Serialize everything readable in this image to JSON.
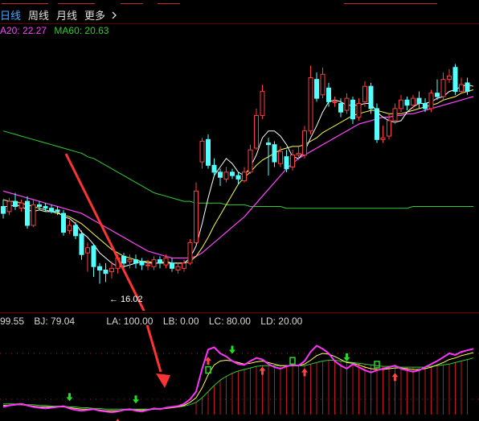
{
  "period_tabs": [
    {
      "label": "日线",
      "active": true
    },
    {
      "label": "周线",
      "active": false
    },
    {
      "label": "月线",
      "active": false
    }
  ],
  "more_menu": {
    "label": "更多",
    "icon": "chevron-right-icon"
  },
  "ma_legend": {
    "ma20": "A20: 22.27",
    "ma60": "MA60: 20.63"
  },
  "indicator_values": {
    "v1": "99.55",
    "bj": "BJ: 79.04",
    "la": "LA: 100.00",
    "lb": "LB: 0.00",
    "lc": "LC: 80.00",
    "ld": "LD: 20.00"
  },
  "low_price_label": "← 16.02",
  "colors": {
    "background": "#000000",
    "up_candle": "#ff3b3b",
    "down_candle": "#54ffff",
    "ma5": "#ffffff",
    "ma10": "#ffff55",
    "ma20": "#ff44ff",
    "ma60": "#33cc33",
    "annotation_arrow": "#ff3333",
    "buy_signal": "#ff4444",
    "sell_signal": "#22dd22",
    "indicator_line_main": "#ff33ff"
  },
  "candles": [
    {
      "o": 20.6,
      "c": 20.2,
      "h": 21.0,
      "l": 19.9
    },
    {
      "o": 20.3,
      "c": 20.9,
      "h": 21.1,
      "l": 20.1
    },
    {
      "o": 20.9,
      "c": 20.6,
      "h": 21.4,
      "l": 20.4
    },
    {
      "o": 20.5,
      "c": 20.8,
      "h": 21.0,
      "l": 20.3
    },
    {
      "o": 20.9,
      "c": 19.5,
      "h": 21.2,
      "l": 19.3
    },
    {
      "o": 19.5,
      "c": 20.7,
      "h": 21.0,
      "l": 19.4
    },
    {
      "o": 20.7,
      "c": 20.6,
      "h": 20.9,
      "l": 20.4
    },
    {
      "o": 20.6,
      "c": 20.5,
      "h": 20.8,
      "l": 20.3
    },
    {
      "o": 20.5,
      "c": 20.3,
      "h": 20.7,
      "l": 20.2
    },
    {
      "o": 20.4,
      "c": 20.3,
      "h": 20.6,
      "l": 20.1
    },
    {
      "o": 20.2,
      "c": 19.1,
      "h": 20.4,
      "l": 18.9
    },
    {
      "o": 19.2,
      "c": 19.5,
      "h": 19.8,
      "l": 19.0
    },
    {
      "o": 19.5,
      "c": 18.9,
      "h": 19.7,
      "l": 18.7
    },
    {
      "o": 19.0,
      "c": 17.8,
      "h": 19.2,
      "l": 17.5
    },
    {
      "o": 17.9,
      "c": 18.2,
      "h": 18.5,
      "l": 16.8
    },
    {
      "o": 18.3,
      "c": 17.1,
      "h": 18.4,
      "l": 16.5
    },
    {
      "o": 17.1,
      "c": 16.9,
      "h": 17.3,
      "l": 16.1
    },
    {
      "o": 16.9,
      "c": 16.7,
      "h": 17.3,
      "l": 16.2
    },
    {
      "o": 16.8,
      "c": 17.0,
      "h": 17.4,
      "l": 16.4
    },
    {
      "o": 17.0,
      "c": 17.6,
      "h": 17.8,
      "l": 16.7
    },
    {
      "o": 17.7,
      "c": 17.3,
      "h": 17.9,
      "l": 17.0
    },
    {
      "o": 17.4,
      "c": 17.5,
      "h": 17.8,
      "l": 17.0
    },
    {
      "o": 17.5,
      "c": 17.3,
      "h": 17.8,
      "l": 17.0
    },
    {
      "o": 17.4,
      "c": 17.2,
      "h": 17.6,
      "l": 16.9
    },
    {
      "o": 17.2,
      "c": 17.2,
      "h": 17.5,
      "l": 16.9
    },
    {
      "o": 17.1,
      "c": 17.5,
      "h": 17.7,
      "l": 16.9
    },
    {
      "o": 17.5,
      "c": 17.3,
      "h": 17.7,
      "l": 17.0
    },
    {
      "o": 17.2,
      "c": 17.6,
      "h": 17.8,
      "l": 17.0
    },
    {
      "o": 17.3,
      "c": 17.0,
      "h": 17.6,
      "l": 16.8
    },
    {
      "o": 16.9,
      "c": 17.1,
      "h": 17.3,
      "l": 16.7
    },
    {
      "o": 17.0,
      "c": 17.3,
      "h": 17.5,
      "l": 16.8
    },
    {
      "o": 17.3,
      "c": 18.5,
      "h": 18.7,
      "l": 17.2
    },
    {
      "o": 18.5,
      "c": 21.5,
      "h": 22.0,
      "l": 18.4
    },
    {
      "o": 23.2,
      "c": 24.4,
      "h": 24.6,
      "l": 22.8
    },
    {
      "o": 24.5,
      "c": 23.0,
      "h": 24.8,
      "l": 22.8
    },
    {
      "o": 23.0,
      "c": 22.6,
      "h": 23.4,
      "l": 22.4
    },
    {
      "o": 22.6,
      "c": 22.3,
      "h": 22.8,
      "l": 21.8
    },
    {
      "o": 22.2,
      "c": 22.6,
      "h": 22.9,
      "l": 22.0
    },
    {
      "o": 22.6,
      "c": 22.4,
      "h": 22.8,
      "l": 22.2
    },
    {
      "o": 22.4,
      "c": 22.2,
      "h": 22.6,
      "l": 21.9
    },
    {
      "o": 22.1,
      "c": 22.6,
      "h": 22.9,
      "l": 22.0
    },
    {
      "o": 22.6,
      "c": 23.9,
      "h": 24.2,
      "l": 22.5
    },
    {
      "o": 24.0,
      "c": 25.9,
      "h": 26.3,
      "l": 23.9
    },
    {
      "o": 25.9,
      "c": 27.3,
      "h": 27.7,
      "l": 25.7
    },
    {
      "o": 24.3,
      "c": 24.2,
      "h": 24.6,
      "l": 22.4
    },
    {
      "o": 24.2,
      "c": 23.2,
      "h": 24.4,
      "l": 22.9
    },
    {
      "o": 23.1,
      "c": 23.8,
      "h": 24.1,
      "l": 22.9
    },
    {
      "o": 23.5,
      "c": 22.8,
      "h": 23.9,
      "l": 22.6
    },
    {
      "o": 22.9,
      "c": 23.6,
      "h": 23.9,
      "l": 22.7
    },
    {
      "o": 23.6,
      "c": 23.7,
      "h": 24.1,
      "l": 23.3
    },
    {
      "o": 23.6,
      "c": 25.0,
      "h": 25.3,
      "l": 23.4
    },
    {
      "o": 25.0,
      "c": 28.1,
      "h": 28.8,
      "l": 24.8
    },
    {
      "o": 28.0,
      "c": 26.9,
      "h": 28.4,
      "l": 26.7
    },
    {
      "o": 27.1,
      "c": 28.3,
      "h": 28.7,
      "l": 26.9
    },
    {
      "o": 27.5,
      "c": 26.7,
      "h": 27.8,
      "l": 26.4
    },
    {
      "o": 26.7,
      "c": 26.7,
      "h": 27.0,
      "l": 26.4
    },
    {
      "o": 26.6,
      "c": 26.1,
      "h": 26.9,
      "l": 25.8
    },
    {
      "o": 26.2,
      "c": 26.9,
      "h": 27.2,
      "l": 26.0
    },
    {
      "o": 26.8,
      "c": 25.7,
      "h": 27.0,
      "l": 25.4
    },
    {
      "o": 25.8,
      "c": 26.6,
      "h": 26.9,
      "l": 25.6
    },
    {
      "o": 26.7,
      "c": 27.6,
      "h": 27.9,
      "l": 26.4
    },
    {
      "o": 27.6,
      "c": 26.3,
      "h": 27.8,
      "l": 26.0
    },
    {
      "o": 26.3,
      "c": 24.5,
      "h": 26.6,
      "l": 24.3
    },
    {
      "o": 24.5,
      "c": 24.6,
      "h": 25.3,
      "l": 24.3
    },
    {
      "o": 24.7,
      "c": 25.6,
      "h": 26.0,
      "l": 24.5
    },
    {
      "o": 25.6,
      "c": 26.3,
      "h": 26.6,
      "l": 25.4
    },
    {
      "o": 26.3,
      "c": 26.8,
      "h": 27.1,
      "l": 26.1
    },
    {
      "o": 26.8,
      "c": 26.5,
      "h": 27.0,
      "l": 26.2
    },
    {
      "o": 26.5,
      "c": 26.9,
      "h": 27.1,
      "l": 26.3
    },
    {
      "o": 26.9,
      "c": 26.6,
      "h": 27.3,
      "l": 26.3
    },
    {
      "o": 26.6,
      "c": 26.3,
      "h": 26.9,
      "l": 26.1
    },
    {
      "o": 26.3,
      "c": 27.2,
      "h": 27.4,
      "l": 26.1
    },
    {
      "o": 27.2,
      "c": 27.0,
      "h": 28.0,
      "l": 26.8
    },
    {
      "o": 27.0,
      "c": 28.0,
      "h": 28.4,
      "l": 26.8
    },
    {
      "o": 28.0,
      "c": 28.2,
      "h": 28.6,
      "l": 27.8
    },
    {
      "o": 28.7,
      "c": 27.3,
      "h": 28.9,
      "l": 27.1
    },
    {
      "o": 27.3,
      "c": 27.7,
      "h": 28.1,
      "l": 27.2
    },
    {
      "o": 27.8,
      "c": 27.3,
      "h": 28.1,
      "l": 27.1
    }
  ],
  "ma_lines": {
    "ma5": [
      20.6,
      20.6,
      20.7,
      20.6,
      20.4,
      20.3,
      20.4,
      20.3,
      20.3,
      20.3,
      20.0,
      19.9,
      19.6,
      19.1,
      18.8,
      18.4,
      17.9,
      17.6,
      17.3,
      17.1,
      17.1,
      17.2,
      17.3,
      17.4,
      17.3,
      17.3,
      17.3,
      17.4,
      17.3,
      17.3,
      17.3,
      17.6,
      18.3,
      19.6,
      21.1,
      22.4,
      22.9,
      23.4,
      23.1,
      22.6,
      22.4,
      22.9,
      23.6,
      24.6,
      25.0,
      25.0,
      24.7,
      24.2,
      23.5,
      23.4,
      23.8,
      24.6,
      25.3,
      26.1,
      26.7,
      26.8,
      26.7,
      26.5,
      26.5,
      26.5,
      26.6,
      26.6,
      26.1,
      25.8,
      25.6,
      25.5,
      25.6,
      26.1,
      26.4,
      26.6,
      26.6,
      26.7,
      26.9,
      27.0,
      27.3,
      27.4,
      27.6,
      27.7,
      27.6
    ],
    "ma10": [
      21.0,
      20.9,
      20.9,
      20.8,
      20.7,
      20.6,
      20.5,
      20.4,
      20.3,
      20.2,
      20.1,
      20.0,
      19.8,
      19.6,
      19.3,
      19.0,
      18.7,
      18.4,
      18.1,
      17.9,
      17.7,
      17.6,
      17.5,
      17.4,
      17.4,
      17.3,
      17.3,
      17.3,
      17.3,
      17.3,
      17.3,
      17.4,
      17.7,
      18.2,
      18.8,
      19.5,
      20.1,
      20.7,
      21.3,
      21.9,
      22.3,
      22.6,
      23.0,
      23.3,
      23.5,
      23.7,
      23.9,
      24.0,
      24.1,
      24.1,
      24.2,
      24.4,
      24.6,
      24.9,
      25.1,
      25.3,
      25.5,
      25.7,
      25.9,
      26.0,
      26.1,
      26.2,
      26.2,
      26.1,
      26.0,
      26.0,
      26.0,
      26.1,
      26.2,
      26.3,
      26.4,
      26.5,
      26.6,
      26.8,
      26.9,
      27.0,
      27.2,
      27.3,
      27.4
    ],
    "ma20": [
      21.5,
      21.4,
      21.3,
      21.2,
      21.1,
      21.0,
      20.9,
      20.8,
      20.7,
      20.6,
      20.5,
      20.4,
      20.3,
      20.2,
      20.0,
      19.8,
      19.6,
      19.4,
      19.2,
      19.0,
      18.8,
      18.6,
      18.4,
      18.2,
      18.0,
      17.9,
      17.8,
      17.7,
      17.6,
      17.6,
      17.6,
      17.6,
      17.7,
      17.9,
      18.2,
      18.5,
      18.8,
      19.1,
      19.4,
      19.7,
      20.0,
      20.4,
      20.8,
      21.2,
      21.6,
      22.0,
      22.4,
      22.8,
      23.1,
      23.4,
      23.6,
      23.8,
      24.0,
      24.2,
      24.4,
      24.6,
      24.8,
      25.0,
      25.2,
      25.4,
      25.5,
      25.6,
      25.7,
      25.8,
      25.8,
      25.9,
      25.9,
      26.0,
      26.0,
      26.1,
      26.2,
      26.3,
      26.4,
      26.5,
      26.6,
      26.7,
      26.8,
      26.9,
      27.0
    ],
    "ma60": [
      25.0,
      24.9,
      24.8,
      24.7,
      24.6,
      24.5,
      24.4,
      24.3,
      24.2,
      24.1,
      24.0,
      23.9,
      23.8,
      23.7,
      23.5,
      23.4,
      23.2,
      23.0,
      22.8,
      22.6,
      22.4,
      22.2,
      22.0,
      21.8,
      21.6,
      21.4,
      21.3,
      21.2,
      21.1,
      21.0,
      20.9,
      20.9,
      20.8,
      20.8,
      20.8,
      20.8,
      20.8,
      20.7,
      20.7,
      20.7,
      20.7,
      20.6,
      20.6,
      20.6,
      20.6,
      20.6,
      20.6,
      20.5,
      20.5,
      20.5,
      20.5,
      20.5,
      20.5,
      20.5,
      20.5,
      20.5,
      20.5,
      20.5,
      20.5,
      20.5,
      20.5,
      20.5,
      20.5,
      20.5,
      20.5,
      20.5,
      20.5,
      20.5,
      20.6,
      20.6,
      20.6,
      20.6,
      20.6,
      20.6,
      20.6,
      20.6,
      20.6,
      20.6,
      20.6
    ]
  },
  "price_range": [
    15.0,
    30.0
  ],
  "indicator": {
    "main": [
      10,
      12,
      13,
      14,
      12,
      10,
      9,
      8,
      9,
      10,
      11,
      8,
      6,
      5,
      6,
      7,
      5,
      4,
      3,
      4,
      6,
      7,
      5,
      4,
      6,
      8,
      7,
      9,
      10,
      11,
      14,
      20,
      30,
      60,
      85,
      88,
      80,
      76,
      70,
      66,
      65,
      70,
      74,
      72,
      66,
      62,
      60,
      63,
      65,
      64,
      70,
      82,
      90,
      86,
      80,
      70,
      64,
      60,
      66,
      62,
      58,
      55,
      58,
      60,
      62,
      64,
      60,
      58,
      56,
      58,
      62,
      66,
      70,
      75,
      80,
      78,
      82,
      84,
      86
    ],
    "sig1": [
      12,
      12,
      13,
      13,
      12,
      11,
      10,
      10,
      10,
      10,
      10,
      9,
      8,
      7,
      7,
      7,
      6,
      5,
      5,
      5,
      6,
      6,
      6,
      6,
      6,
      7,
      7,
      8,
      9,
      10,
      12,
      16,
      22,
      35,
      52,
      65,
      70,
      71,
      70,
      68,
      66,
      67,
      69,
      70,
      68,
      66,
      64,
      64,
      64,
      64,
      66,
      71,
      77,
      80,
      79,
      76,
      72,
      68,
      67,
      65,
      62,
      60,
      59,
      59,
      60,
      61,
      61,
      60,
      59,
      59,
      60,
      62,
      65,
      68,
      72,
      74,
      77,
      79,
      81
    ],
    "sig2": [
      14,
      14,
      14,
      14,
      13,
      13,
      12,
      12,
      11,
      11,
      11,
      10,
      10,
      9,
      9,
      8,
      8,
      7,
      7,
      7,
      7,
      7,
      7,
      7,
      7,
      7,
      8,
      8,
      9,
      10,
      11,
      13,
      16,
      22,
      30,
      38,
      45,
      50,
      54,
      57,
      59,
      61,
      63,
      64,
      64,
      64,
      64,
      64,
      64,
      64,
      64,
      66,
      68,
      70,
      71,
      71,
      70,
      69,
      68,
      67,
      66,
      65,
      64,
      63,
      63,
      63,
      62,
      62,
      62,
      62,
      62,
      63,
      64,
      65,
      66,
      68,
      70,
      72,
      74
    ]
  },
  "bars_from": 32,
  "buy_signals": [
    19,
    34,
    43,
    50,
    65
  ],
  "sell_signals": [
    11,
    22,
    38,
    57
  ],
  "s_marks": [
    34,
    48,
    62
  ]
}
